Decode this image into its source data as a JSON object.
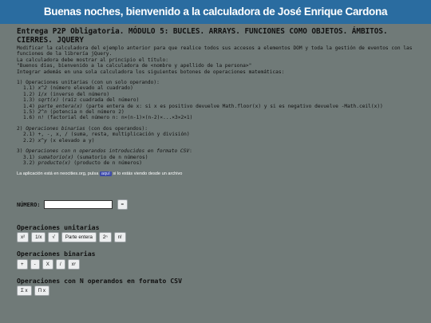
{
  "banner": "Buenas noches, bienvenido a la calculadora de José Enrique Cardona",
  "title_line1": "Entrega P2P Obligatoria. MÓDULO 5: BUCLES. ARRAYS. FUNCIONES COMO OBJETOS. ÁMBITOS.",
  "title_line2": "CIERRES. JQUERY",
  "desc": [
    "Modificar la calculadora del ejemplo anterior para que realice todos sus accesos a elementos DOM y toda la gestión de eventos con las",
    "funciones de la librería jQuery.",
    "La calculadora debe mostrar al principio el título:",
    "\"Buenos días, bienvenido a la calculadora de <nombre y apellido de la persona>\"",
    "Integrar además en una sola calculadora los siguientes botones de operaciones matemáticas:"
  ],
  "s1": {
    "head": "1) Operaciones unitarias (con un solo operando):",
    "items": [
      {
        "n": "1.1)",
        "fn": "x^2",
        "txt": " (número elevado al cuadrado)"
      },
      {
        "n": "1.2)",
        "fn": "1/x",
        "txt": " (inverso del número)"
      },
      {
        "n": "1.3)",
        "fn": "sqrt(x)",
        "txt": " (raíz cuadrada del número)"
      },
      {
        "n": "1.4)",
        "fn": "parte_entera(x)",
        "txt": " (parte entera de x: si x es positivo devuelve Math.floor(x) y si es negativo devuelve -Math.ceil(x))"
      },
      {
        "n": "1.5)",
        "fn": "2^n",
        "txt": " (potencia n del número 2)"
      },
      {
        "n": "1.6)",
        "fn": "n!",
        "txt": " (factorial del número n: n×(n-1)×(n-2)×...×3×2×1)"
      }
    ]
  },
  "s2": {
    "head_num": "2) ",
    "head_it": "Operaciones binarias",
    "head_rest": " (con dos operandos):",
    "items": [
      {
        "n": "2.1)",
        "fn": "",
        "txt": " +, -, x, / (suma, resta, multiplicación y división)"
      },
      {
        "n": "2.2)",
        "fn": "x^y",
        "txt": " (x elevado a y)"
      }
    ]
  },
  "s3": {
    "head_num": "3) ",
    "head_it": "Operaciones con n operandos introducidos en formato CSV",
    "head_rest": ":",
    "items": [
      {
        "n": "3.1)",
        "fn": "sumatorio(x)",
        "txt": " (sumatorio de n números)"
      },
      {
        "n": "3.2)",
        "fn": "producto(x)",
        "txt": " (producto de n números)"
      }
    ]
  },
  "note": {
    "before": "La aplicación está en neocities.org, pulsa ",
    "link": "aquí",
    "after": " si lo estás viendo desde un archivo"
  },
  "numero": {
    "label": "NÚMERO:",
    "value": "",
    "eq": "="
  },
  "unitarias": {
    "title": "Operaciones unitarias",
    "buttons": [
      "x²",
      "1/x",
      "√",
      "Parte entera",
      "2ⁿ",
      "n!"
    ]
  },
  "binarias": {
    "title": "Operaciones binarias",
    "buttons": [
      "+",
      "-",
      "X",
      "/",
      "xʸ"
    ]
  },
  "csv": {
    "title": "Operaciones con N operandos en formato CSV",
    "buttons": [
      "Σ x",
      "Π x"
    ]
  }
}
